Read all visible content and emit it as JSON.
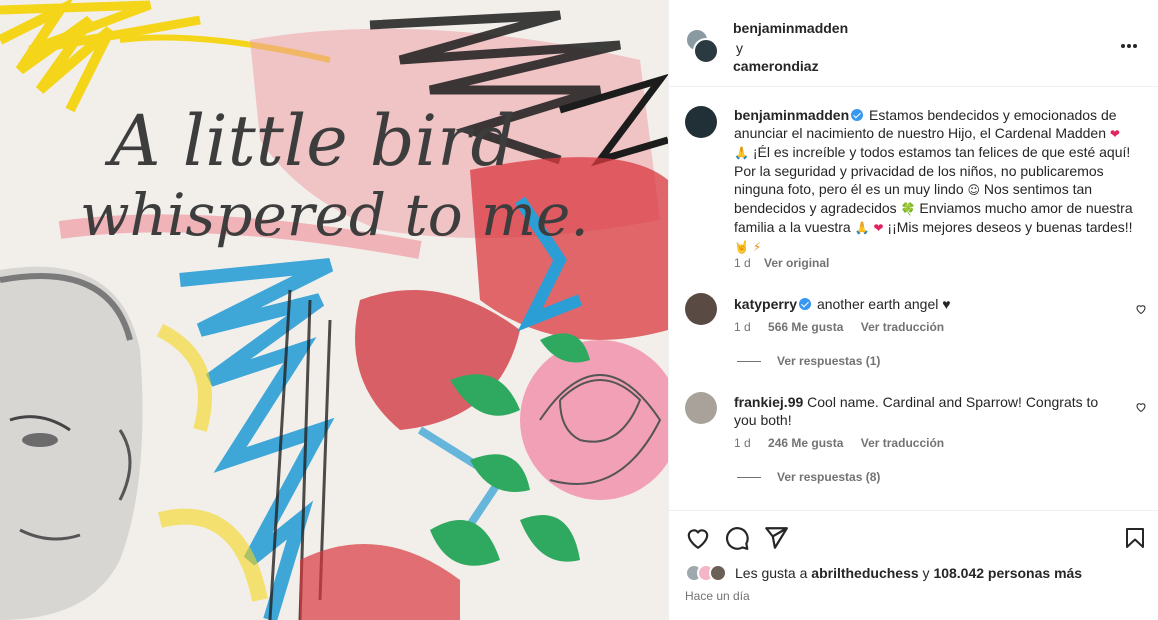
{
  "header": {
    "user1": "benjaminmadden",
    "connector": "y",
    "user2": "camerondiaz"
  },
  "caption": {
    "username": "benjaminmadden",
    "text_1": "Estamos bendecidos y emocionados de anunciar el nacimiento de nuestro Hijo, el Cardenal Madden",
    "emoji_heart": "❤",
    "emoji_pray": "🙏",
    "text_2": "¡Él es increíble y todos estamos tan felices de que esté aquí! Por la seguridad y privacidad de los niños, no publicaremos ninguna foto, pero él es un muy lindo",
    "emoji_smile": "☺",
    "text_3": "Nos sentimos tan bendecidos y agradecidos",
    "emoji_clover": "🍀",
    "text_4": "Enviamos mucho amor de nuestra familia a la vuestra",
    "emoji_pray2": "🙏",
    "emoji_heart2": "❤",
    "text_5": "¡¡Mis mejores deseos y buenas tardes!!",
    "emoji_hand": "🤘",
    "emoji_bolt": "⚡",
    "time": "1 d",
    "see_original": "Ver original"
  },
  "comments": [
    {
      "username": "katyperry",
      "text": "another earth angel ♥",
      "time": "1 d",
      "likes": "566 Me gusta",
      "translate": "Ver traducción",
      "replies": "Ver respuestas (1)"
    },
    {
      "username": "frankiej.99",
      "text": "Cool name. Cardinal and Sparrow! Congrats to you both!",
      "time": "1 d",
      "likes": "246 Me gusta",
      "translate": "Ver traducción",
      "replies": "Ver respuestas (8)"
    }
  ],
  "likes_bar": {
    "prefix": "Les gusta a",
    "user": "abriltheduchess",
    "connector": "y",
    "count": "108.042 personas más",
    "time": "Hace un día"
  },
  "artwork": {
    "line1": "A little bird",
    "line2": "whispered to me."
  },
  "icons": [
    "heart-icon",
    "comment-icon",
    "share-icon",
    "bookmark-icon",
    "more-icon"
  ],
  "colors": {
    "verified": "#3897f0",
    "muted": "#737373",
    "text": "#262626"
  }
}
